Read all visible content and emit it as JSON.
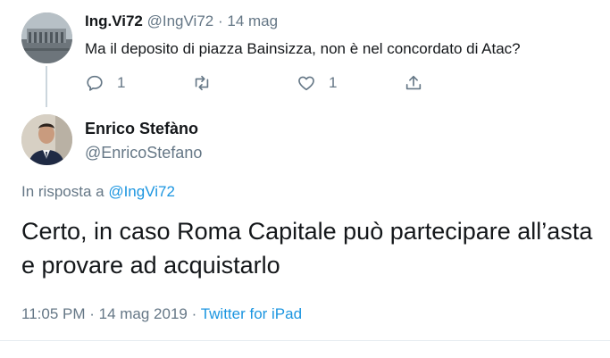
{
  "reply_tweet": {
    "author_name": "Ing.Vi72",
    "author_handle": "@IngVi72",
    "separator": "·",
    "date": "14 mag",
    "text": "Ma il deposito di piazza Bainsizza, non è nel concordato di Atac?",
    "reply_count": "1",
    "like_count": "1",
    "icons": {
      "reply": "reply-icon",
      "retweet": "retweet-icon",
      "like": "heart-icon",
      "share": "share-icon"
    }
  },
  "main_tweet": {
    "author_name": "Enrico Stefàno",
    "author_handle": "@EnricoStefano",
    "in_reply_prefix": "In risposta a ",
    "in_reply_mention": "@IngVi72",
    "text": "Certo, in caso Roma Capitale può partecipare all’asta e provare ad acquistarlo",
    "time": "11:05 PM",
    "meta_sep_1": " · ",
    "date": "14 mag 2019",
    "meta_sep_2": " · ",
    "source": "Twitter for iPad"
  },
  "colors": {
    "text": "#14171a",
    "secondary": "#657786",
    "link": "#1b95e0",
    "divider": "#e6ecf0"
  }
}
